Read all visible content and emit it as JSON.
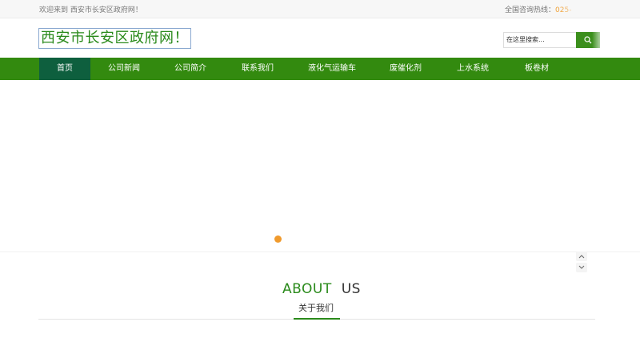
{
  "topbar": {
    "welcome": "欢迎来到 西安市长安区政府网！",
    "hotline_label": "全国咨询热线：",
    "hotline_number": "025-"
  },
  "header": {
    "logo_text": "西安市长安区政府网！"
  },
  "search": {
    "placeholder": "在这里搜索...",
    "icon": "search-icon"
  },
  "nav": {
    "items": [
      {
        "label": "首页"
      },
      {
        "label": "公司新闻"
      },
      {
        "label": "公司简介"
      },
      {
        "label": "联系我们"
      },
      {
        "label": "液化气运输车"
      },
      {
        "label": "废催化剂"
      },
      {
        "label": "上水系统"
      },
      {
        "label": "板卷材"
      }
    ],
    "active_index": 0
  },
  "slider": {
    "dot_color": "#f09a2c"
  },
  "about": {
    "title_a": "ABOUT",
    "title_b": "US",
    "subtitle": "关于我们"
  },
  "colors": {
    "brand_green": "#338a0f",
    "nav_active": "#0e5f3e",
    "accent_orange": "#f0a23a"
  }
}
